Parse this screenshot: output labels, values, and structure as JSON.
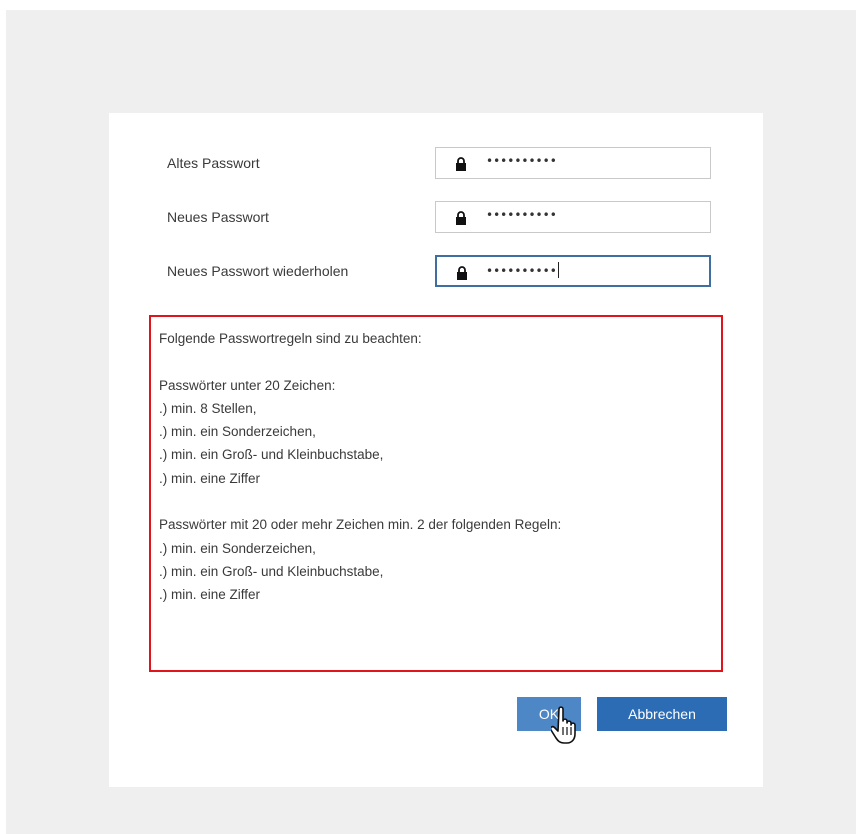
{
  "fields": [
    {
      "label": "Altes Passwort",
      "value": "••••••••••"
    },
    {
      "label": "Neues Passwort",
      "value": "••••••••••"
    },
    {
      "label": "Neues Passwort wiederholen",
      "value": "••••••••••"
    }
  ],
  "rules": {
    "lines": [
      "Folgende Passwortregeln sind zu beachten:",
      "",
      "Passwörter unter 20 Zeichen:",
      ".) min. 8 Stellen,",
      ".) min. ein Sonderzeichen,",
      ".) min. ein Groß- und Kleinbuchstabe,",
      ".) min. eine Ziffer",
      "",
      "Passwörter mit 20 oder mehr Zeichen min. 2 der folgenden Regeln:",
      ".) min. ein Sonderzeichen,",
      ".) min. ein Groß- und Kleinbuchstabe,",
      ".) min. eine Ziffer"
    ],
    "border_color": "#e0151b"
  },
  "buttons": {
    "ok_label": "OK",
    "cancel_label": "Abbrechen"
  },
  "colors": {
    "primary_button": "#2c6cb5",
    "hover_button": "#4d87c6",
    "focus_border": "#3f6fa0"
  },
  "icons": {
    "field": "lock-icon",
    "pointer": "hand-pointer-cursor-icon"
  }
}
